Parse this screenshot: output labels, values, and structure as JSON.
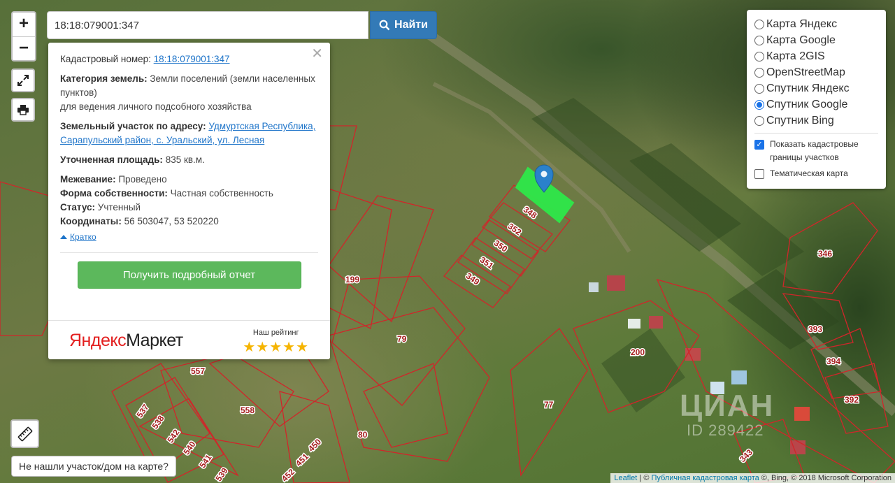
{
  "search": {
    "value": "18:18:079001:347",
    "button_label": "Найти"
  },
  "zoom": {
    "in_label": "+",
    "out_label": "−"
  },
  "popup": {
    "cadastral_label": "Кадастровый номер:",
    "cadastral_value": "18:18:079001:347",
    "category_label": "Категория земель:",
    "category_value": "Земли поселений (земли населенных пунктов)",
    "category_purpose": "для ведения личного подсобного хозяйства",
    "address_label": "Земельный участок по адресу:",
    "address_value": "Удмуртская Республика, Сарапульский район, с. Уральский, ул. Лесная",
    "area_label": "Уточненная площадь:",
    "area_value": "835 кв.м.",
    "survey_label": "Межевание:",
    "survey_value": "Проведено",
    "ownership_label": "Форма собственности:",
    "ownership_value": "Частная собственность",
    "status_label": "Статус:",
    "status_value": "Учтенный",
    "coords_label": "Координаты:",
    "coords_value": "56 503047, 53 520220",
    "short_link": "Кратко",
    "report_button": "Получить подробный отчет",
    "market_logo_part1": "Яндекс",
    "market_logo_part2": "Маркет",
    "rating_label": "Наш рейтинг",
    "stars": "★★★★★"
  },
  "layers": {
    "options": [
      {
        "label": "Карта Яндекс",
        "selected": false
      },
      {
        "label": "Карта Google",
        "selected": false
      },
      {
        "label": "Карта 2GIS",
        "selected": false
      },
      {
        "label": "OpenStreetMap",
        "selected": false
      },
      {
        "label": "Спутник Яндекс",
        "selected": false
      },
      {
        "label": "Спутник Google",
        "selected": true
      },
      {
        "label": "Спутник Bing",
        "selected": false
      }
    ],
    "show_borders_label": "Показать кадастровые границы участков",
    "show_borders_checked": true,
    "thematic_label": "Тематическая карта",
    "thematic_checked": false
  },
  "map": {
    "lot_labels": [
      "348",
      "352",
      "350",
      "351",
      "349",
      "199",
      "79",
      "557",
      "558",
      "537",
      "538",
      "542",
      "540",
      "541",
      "539",
      "450",
      "451",
      "452",
      "80",
      "77",
      "200",
      "346",
      "393",
      "394",
      "392",
      "343"
    ],
    "highlight_color": "#2ee84a",
    "border_color": "#d0262a"
  },
  "not_found_button": "Не нашли участок/дом на карте?",
  "attribution": {
    "leaflet": "Leaflet",
    "separator1": " | © ",
    "pkk": "Публичная кадастровая карта",
    "rest": " ©, Bing, © 2018 Microsoft Corporation"
  },
  "watermark": {
    "brand": "ЦИАН",
    "id": "ID 289422"
  }
}
